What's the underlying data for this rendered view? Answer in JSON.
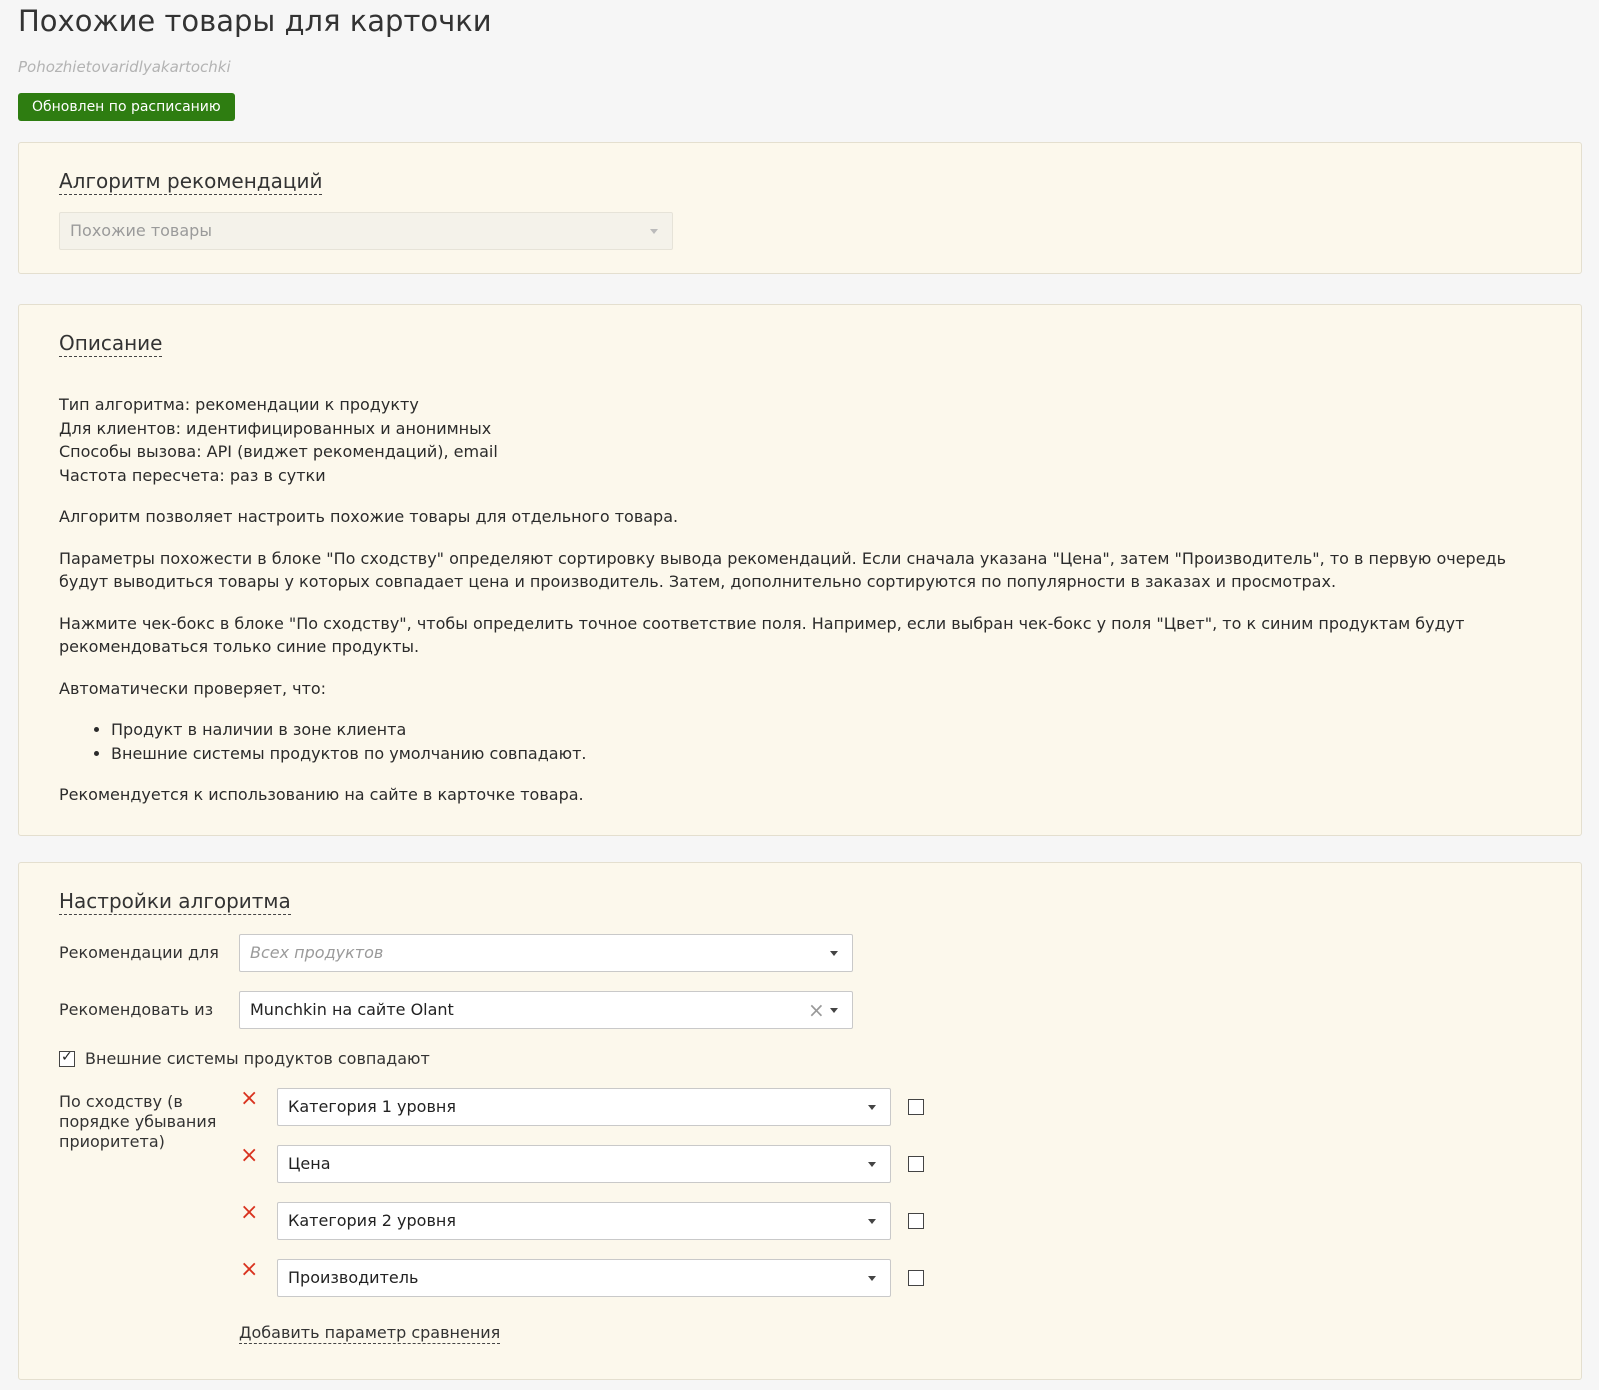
{
  "page": {
    "title": "Похожие товары для карточки",
    "system_name": "Pohozhietovaridlyakartochki",
    "status_badge": "Обновлен по расписанию"
  },
  "algorithm_panel": {
    "title": "Алгоритм рекомендаций",
    "select_value": "Похожие товары"
  },
  "description_panel": {
    "title": "Описание",
    "lines": [
      "Тип алгоритма: рекомендации к продукту",
      "Для клиентов: идентифицированных и анонимных",
      "Способы вызова: API (виджет рекомендаций), email",
      "Частота пересчета: раз в сутки"
    ],
    "paragraph_1": "Алгоритм позволяет настроить похожие товары для отдельного товара.",
    "paragraph_2": "Параметры похожести в блоке \"По сходству\" определяют сортировку вывода рекомендаций. Если сначала указана \"Цена\", затем \"Производитель\", то в первую очередь будут выводиться товары у которых совпадает цена и производитель. Затем, дополнительно сортируются по популярности в заказах и просмотрах.",
    "paragraph_3": "Нажмите чек-бокс в блоке \"По сходству\", чтобы определить точное соответствие поля. Например, если выбран чек-бокс у поля \"Цвет\", то к синим продуктам будут рекомендоваться только синие продукты.",
    "paragraph_4": "Автоматически проверяет, что:",
    "bullets": [
      "Продукт в наличии в зоне клиента",
      "Внешние системы продуктов по умолчанию совпадают."
    ],
    "paragraph_5": "Рекомендуется к использованию на сайте в карточке товара."
  },
  "settings_panel": {
    "title": "Настройки алгоритма",
    "recommendations_for_label": "Рекомендации для",
    "recommendations_for_placeholder": "Всех продуктов",
    "recommend_from_label": "Рекомендовать из",
    "recommend_from_value": "Munchkin на сайте Olant",
    "clear_symbol": "×",
    "external_systems_label": "Внешние системы продуктов совпадают",
    "external_systems_checked": true,
    "similarity_label": "По сходству (в порядке убывания приоритета)",
    "remove_symbol": "×",
    "similarity_params": [
      {
        "value": "Категория 1 уровня",
        "exact": false
      },
      {
        "value": "Цена",
        "exact": false
      },
      {
        "value": "Категория 2 уровня",
        "exact": false
      },
      {
        "value": "Производитель",
        "exact": false
      }
    ],
    "add_param_link": "Добавить параметр сравнения"
  },
  "icons": {
    "remove": "close-icon",
    "caret": "chevron-down-icon",
    "clear": "clear-icon",
    "checkbox": "checkbox-icon"
  },
  "colors": {
    "status_badge": "#2e7d11",
    "panel_background": "#fcf8ec",
    "remove_icon": "#d9331f"
  }
}
